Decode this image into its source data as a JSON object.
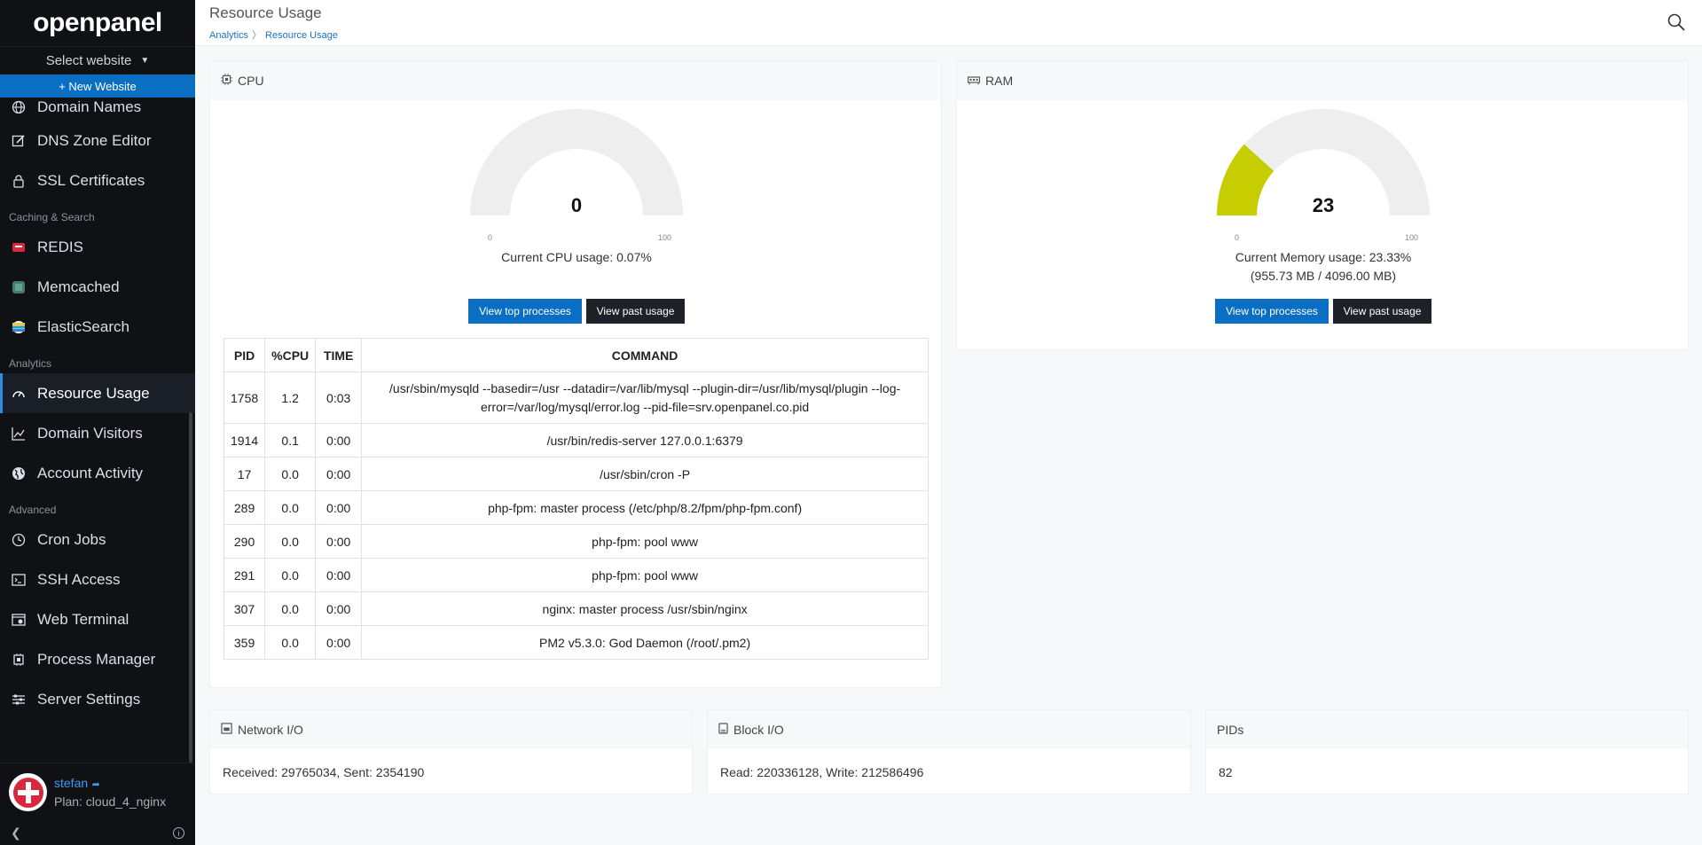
{
  "app": {
    "brand": "openpanel"
  },
  "sidebar": {
    "select_website": "Select website",
    "new_website": "+ New Website",
    "items_top": [
      {
        "label": "Domain Names",
        "icon": "globe-icon"
      },
      {
        "label": "DNS Zone Editor",
        "icon": "edit-icon"
      },
      {
        "label": "SSL Certificates",
        "icon": "lock-icon"
      }
    ],
    "section_caching": "Caching & Search",
    "items_caching": [
      {
        "label": "REDIS",
        "icon": "redis-icon"
      },
      {
        "label": "Memcached",
        "icon": "memcached-icon"
      },
      {
        "label": "ElasticSearch",
        "icon": "elasticsearch-icon"
      }
    ],
    "section_analytics": "Analytics",
    "items_analytics": [
      {
        "label": "Resource Usage",
        "icon": "gauge-icon"
      },
      {
        "label": "Domain Visitors",
        "icon": "chart-line-icon"
      },
      {
        "label": "Account Activity",
        "icon": "globe-activity-icon"
      }
    ],
    "section_advanced": "Advanced",
    "items_advanced": [
      {
        "label": "Cron Jobs",
        "icon": "clock-icon"
      },
      {
        "label": "SSH Access",
        "icon": "terminal-icon"
      },
      {
        "label": "Web Terminal",
        "icon": "web-terminal-icon"
      },
      {
        "label": "Process Manager",
        "icon": "cpu-icon"
      },
      {
        "label": "Server Settings",
        "icon": "sliders-icon"
      }
    ],
    "user": {
      "name": "stefan",
      "plan": "Plan: cloud_4_nginx"
    }
  },
  "header": {
    "title": "Resource Usage",
    "breadcrumb": [
      "Analytics",
      "Resource Usage"
    ]
  },
  "cpu": {
    "title": "CPU",
    "value": "0",
    "fraction": 0.0,
    "min": "0",
    "max": "100",
    "usage_text": "Current CPU usage: 0.07%",
    "btn_top": "View top processes",
    "btn_past": "View past usage",
    "table": {
      "headers": [
        "PID",
        "%CPU",
        "TIME",
        "COMMAND"
      ],
      "rows": [
        [
          "1758",
          "1.2",
          "0:03",
          "/usr/sbin/mysqld --basedir=/usr --datadir=/var/lib/mysql --plugin-dir=/usr/lib/mysql/plugin --log-error=/var/log/mysql/error.log --pid-file=srv.openpanel.co.pid"
        ],
        [
          "1914",
          "0.1",
          "0:00",
          "/usr/bin/redis-server 127.0.0.1:6379"
        ],
        [
          "17",
          "0.0",
          "0:00",
          "/usr/sbin/cron -P"
        ],
        [
          "289",
          "0.0",
          "0:00",
          "php-fpm: master process (/etc/php/8.2/fpm/php-fpm.conf)"
        ],
        [
          "290",
          "0.0",
          "0:00",
          "php-fpm: pool www"
        ],
        [
          "291",
          "0.0",
          "0:00",
          "php-fpm: pool www"
        ],
        [
          "307",
          "0.0",
          "0:00",
          "nginx: master process /usr/sbin/nginx"
        ],
        [
          "359",
          "0.0",
          "0:00",
          "PM2 v5.3.0: God Daemon (/root/.pm2)"
        ]
      ]
    }
  },
  "ram": {
    "title": "RAM",
    "value": "23",
    "fraction": 0.2333,
    "min": "0",
    "max": "100",
    "usage_line1": "Current Memory usage: 23.33%",
    "usage_line2": "(955.73 MB / 4096.00 MB)",
    "btn_top": "View top processes",
    "btn_past": "View past usage"
  },
  "network": {
    "title": "Network I/O",
    "text": "Received: 29765034, Sent: 2354190"
  },
  "block": {
    "title": "Block I/O",
    "text": "Read: 220336128, Write: 212586496"
  },
  "pids": {
    "title": "PIDs",
    "text": "82"
  },
  "colors": {
    "accent": "#0a6fc2",
    "gauge_fill": "#c6cd00",
    "gauge_track": "#eeeeee"
  }
}
